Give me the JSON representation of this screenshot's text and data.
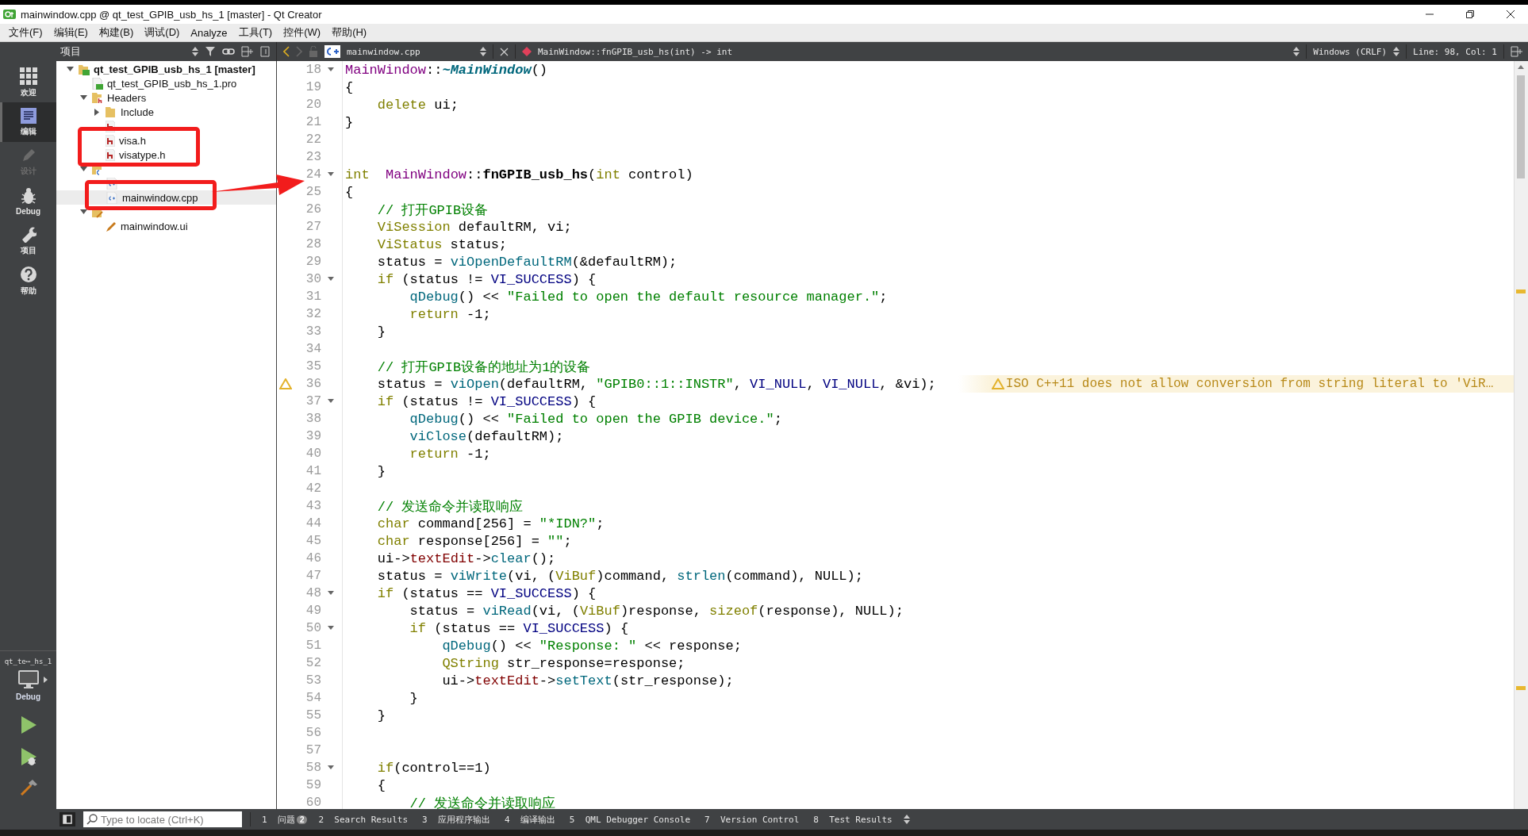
{
  "window": {
    "title": "mainwindow.cpp @ qt_test_GPIB_usb_hs_1 [master] - Qt Creator"
  },
  "menu": [
    "文件(F)",
    "编辑(E)",
    "构建(B)",
    "调试(D)",
    "Analyze",
    "工具(T)",
    "控件(W)",
    "帮助(H)"
  ],
  "modes": [
    {
      "label": "欢迎",
      "kind": "welcome",
      "selected": false,
      "disabled": false
    },
    {
      "label": "编辑",
      "kind": "edit",
      "selected": true,
      "disabled": false
    },
    {
      "label": "设计",
      "kind": "design",
      "selected": false,
      "disabled": true
    },
    {
      "label": "Debug",
      "kind": "debug",
      "selected": false,
      "disabled": false
    },
    {
      "label": "项目",
      "kind": "projects",
      "selected": false,
      "disabled": false
    },
    {
      "label": "帮助",
      "kind": "help",
      "selected": false,
      "disabled": false
    }
  ],
  "kit": {
    "project": "qt_te⋯_hs_1",
    "build": "Debug"
  },
  "actions": [
    {
      "kind": "run"
    },
    {
      "kind": "debug_run"
    },
    {
      "kind": "build"
    }
  ],
  "project_pane": {
    "title": "项目",
    "tree": [
      {
        "label": "qt_test_GPIB_usb_hs_1 [master]",
        "kind": "project",
        "expanded": true,
        "selected": false,
        "children": [
          {
            "label": "qt_test_GPIB_usb_hs_1.pro",
            "kind": "pro",
            "selected": false
          },
          {
            "label": "Headers",
            "kind": "headers",
            "expanded": true,
            "selected": false,
            "children": [
              {
                "label": "Include",
                "kind": "folder",
                "expanded": false,
                "selected": false
              },
              {
                "kind": "h",
                "selected": false
              },
              {
                "label": "visa.h",
                "kind": "h",
                "selected": false
              },
              {
                "label": "visatype.h",
                "kind": "h",
                "selected": false
              }
            ]
          },
          {
            "kind": "sources",
            "expanded": true,
            "selected": false,
            "children": [
              {
                "kind": "cpp",
                "selected": false
              },
              {
                "label": "mainwindow.cpp",
                "kind": "cpp",
                "selected": true
              }
            ]
          },
          {
            "kind": "forms",
            "expanded": true,
            "selected": false,
            "children": [
              {
                "label": "mainwindow.ui",
                "kind": "ui",
                "selected": false
              }
            ]
          }
        ]
      }
    ]
  },
  "editor_toolbar": {
    "file": "mainwindow.cpp",
    "symbol": "MainWindow::fnGPIB_usb_hs(int) -> int",
    "line_ending": "Windows (CRLF)",
    "position": "Line: 98, Col: 1"
  },
  "code": [
    {
      "number": "18",
      "foldable": true,
      "tokens": [
        {
          "kind": "cls",
          "text": "MainWindow"
        },
        {
          "kind": "plain",
          "text": "::"
        },
        {
          "kind": "dtor",
          "text": "~MainWindow"
        },
        {
          "kind": "plain",
          "text": "()"
        }
      ]
    },
    {
      "number": "19",
      "foldable": false,
      "tokens": [
        {
          "kind": "plain",
          "text": "{"
        }
      ]
    },
    {
      "number": "20",
      "foldable": false,
      "tokens": [
        {
          "kind": "kw",
          "text": "    delete"
        },
        {
          "kind": "plain",
          "text": " ui;"
        }
      ]
    },
    {
      "number": "21",
      "foldable": false,
      "tokens": [
        {
          "kind": "plain",
          "text": "}"
        }
      ]
    },
    {
      "number": "22",
      "foldable": false
    },
    {
      "number": "23",
      "foldable": false
    },
    {
      "number": "24",
      "foldable": true,
      "tokens": [
        {
          "kind": "kw",
          "text": "int  "
        },
        {
          "kind": "cls",
          "text": "MainWindow"
        },
        {
          "kind": "plain",
          "text": "::"
        },
        {
          "kind": "def",
          "text": "fnGPIB_usb_hs"
        },
        {
          "kind": "plain",
          "text": "("
        },
        {
          "kind": "kw",
          "text": "int"
        },
        {
          "kind": "plain",
          "text": " control)"
        }
      ]
    },
    {
      "number": "25",
      "foldable": false,
      "tokens": [
        {
          "kind": "plain",
          "text": "{"
        }
      ]
    },
    {
      "number": "26",
      "foldable": false,
      "tokens": [
        {
          "kind": "cm",
          "text": "    // 打开GPIB设备"
        }
      ]
    },
    {
      "number": "27",
      "foldable": false,
      "tokens": [
        {
          "kind": "type",
          "text": "    ViSession"
        },
        {
          "kind": "plain",
          "text": " defaultRM, vi;"
        }
      ]
    },
    {
      "number": "28",
      "foldable": false,
      "tokens": [
        {
          "kind": "type",
          "text": "    ViStatus"
        },
        {
          "kind": "plain",
          "text": " status;"
        }
      ]
    },
    {
      "number": "29",
      "foldable": false,
      "tokens": [
        {
          "kind": "plain",
          "text": "    status = "
        },
        {
          "kind": "fn",
          "text": "viOpenDefaultRM"
        },
        {
          "kind": "plain",
          "text": "(&defaultRM);"
        }
      ]
    },
    {
      "number": "30",
      "foldable": true,
      "tokens": [
        {
          "kind": "kw",
          "text": "    if"
        },
        {
          "kind": "plain",
          "text": " (status != "
        },
        {
          "kind": "mac",
          "text": "VI_SUCCESS"
        },
        {
          "kind": "plain",
          "text": ") {"
        }
      ]
    },
    {
      "number": "31",
      "foldable": false,
      "tokens": [
        {
          "kind": "fn",
          "text": "        qDebug"
        },
        {
          "kind": "plain",
          "text": "() << "
        },
        {
          "kind": "str",
          "text": "\"Failed to open the default resource manager.\""
        },
        {
          "kind": "plain",
          "text": ";"
        }
      ]
    },
    {
      "number": "32",
      "foldable": false,
      "tokens": [
        {
          "kind": "kw",
          "text": "        return"
        },
        {
          "kind": "plain",
          "text": " -1;"
        }
      ]
    },
    {
      "number": "33",
      "foldable": false,
      "tokens": [
        {
          "kind": "plain",
          "text": "    }"
        }
      ]
    },
    {
      "number": "34",
      "foldable": false
    },
    {
      "number": "35",
      "foldable": false,
      "tokens": [
        {
          "kind": "cm",
          "text": "    // 打开GPIB设备的地址为1的设备"
        }
      ]
    },
    {
      "number": "36",
      "foldable": false,
      "tokens": [
        {
          "kind": "plain",
          "text": "    status = "
        },
        {
          "kind": "fn",
          "text": "viOpen"
        },
        {
          "kind": "plain",
          "text": "(defaultRM, "
        },
        {
          "kind": "str",
          "text": "\"GPIB0::1::INSTR\""
        },
        {
          "kind": "plain",
          "text": ", "
        },
        {
          "kind": "mac",
          "text": "VI_NULL"
        },
        {
          "kind": "plain",
          "text": ", "
        },
        {
          "kind": "mac",
          "text": "VI_NULL"
        },
        {
          "kind": "plain",
          "text": ", &vi);"
        }
      ],
      "warning": "ISO C++11 does not allow conversion from string literal to 'ViR…"
    },
    {
      "number": "37",
      "foldable": true,
      "tokens": [
        {
          "kind": "kw",
          "text": "    if"
        },
        {
          "kind": "plain",
          "text": " (status != "
        },
        {
          "kind": "mac",
          "text": "VI_SUCCESS"
        },
        {
          "kind": "plain",
          "text": ") {"
        }
      ]
    },
    {
      "number": "38",
      "foldable": false,
      "tokens": [
        {
          "kind": "fn",
          "text": "        qDebug"
        },
        {
          "kind": "plain",
          "text": "() << "
        },
        {
          "kind": "str",
          "text": "\"Failed to open the GPIB device.\""
        },
        {
          "kind": "plain",
          "text": ";"
        }
      ]
    },
    {
      "number": "39",
      "foldable": false,
      "tokens": [
        {
          "kind": "fn",
          "text": "        viClose"
        },
        {
          "kind": "plain",
          "text": "(defaultRM);"
        }
      ]
    },
    {
      "number": "40",
      "foldable": false,
      "tokens": [
        {
          "kind": "kw",
          "text": "        return"
        },
        {
          "kind": "plain",
          "text": " -1;"
        }
      ]
    },
    {
      "number": "41",
      "foldable": false,
      "tokens": [
        {
          "kind": "plain",
          "text": "    }"
        }
      ]
    },
    {
      "number": "42",
      "foldable": false
    },
    {
      "number": "43",
      "foldable": false,
      "tokens": [
        {
          "kind": "cm",
          "text": "    // 发送命令并读取响应"
        }
      ]
    },
    {
      "number": "44",
      "foldable": false,
      "tokens": [
        {
          "kind": "kw",
          "text": "    char"
        },
        {
          "kind": "plain",
          "text": " command[256] = "
        },
        {
          "kind": "str",
          "text": "\"*IDN?\""
        },
        {
          "kind": "plain",
          "text": ";"
        }
      ]
    },
    {
      "number": "45",
      "foldable": false,
      "tokens": [
        {
          "kind": "kw",
          "text": "    char"
        },
        {
          "kind": "plain",
          "text": " response[256] = "
        },
        {
          "kind": "str",
          "text": "\"\""
        },
        {
          "kind": "plain",
          "text": ";"
        }
      ]
    },
    {
      "number": "46",
      "foldable": false,
      "tokens": [
        {
          "kind": "plain",
          "text": "    ui->"
        },
        {
          "kind": "field",
          "text": "textEdit"
        },
        {
          "kind": "plain",
          "text": "->"
        },
        {
          "kind": "fn",
          "text": "clear"
        },
        {
          "kind": "plain",
          "text": "();"
        }
      ]
    },
    {
      "number": "47",
      "foldable": false,
      "tokens": [
        {
          "kind": "plain",
          "text": "    status = "
        },
        {
          "kind": "fn",
          "text": "viWrite"
        },
        {
          "kind": "plain",
          "text": "(vi, ("
        },
        {
          "kind": "type",
          "text": "ViBuf"
        },
        {
          "kind": "plain",
          "text": ")command, "
        },
        {
          "kind": "fn",
          "text": "strlen"
        },
        {
          "kind": "plain",
          "text": "(command), NULL);"
        }
      ]
    },
    {
      "number": "48",
      "foldable": true,
      "tokens": [
        {
          "kind": "kw",
          "text": "    if"
        },
        {
          "kind": "plain",
          "text": " (status == "
        },
        {
          "kind": "mac",
          "text": "VI_SUCCESS"
        },
        {
          "kind": "plain",
          "text": ") {"
        }
      ]
    },
    {
      "number": "49",
      "foldable": false,
      "tokens": [
        {
          "kind": "plain",
          "text": "        status = "
        },
        {
          "kind": "fn",
          "text": "viRead"
        },
        {
          "kind": "plain",
          "text": "(vi, ("
        },
        {
          "kind": "type",
          "text": "ViBuf"
        },
        {
          "kind": "plain",
          "text": ")response, "
        },
        {
          "kind": "kw",
          "text": "sizeof"
        },
        {
          "kind": "plain",
          "text": "(response), NULL);"
        }
      ]
    },
    {
      "number": "50",
      "foldable": true,
      "tokens": [
        {
          "kind": "kw",
          "text": "        if"
        },
        {
          "kind": "plain",
          "text": " (status == "
        },
        {
          "kind": "mac",
          "text": "VI_SUCCESS"
        },
        {
          "kind": "plain",
          "text": ") {"
        }
      ]
    },
    {
      "number": "51",
      "foldable": false,
      "tokens": [
        {
          "kind": "fn",
          "text": "            qDebug"
        },
        {
          "kind": "plain",
          "text": "() << "
        },
        {
          "kind": "str",
          "text": "\"Response: \""
        },
        {
          "kind": "plain",
          "text": " << response;"
        }
      ]
    },
    {
      "number": "52",
      "foldable": false,
      "tokens": [
        {
          "kind": "type",
          "text": "            QString"
        },
        {
          "kind": "plain",
          "text": " str_response=response;"
        }
      ]
    },
    {
      "number": "53",
      "foldable": false,
      "tokens": [
        {
          "kind": "plain",
          "text": "            ui->"
        },
        {
          "kind": "field",
          "text": "textEdit"
        },
        {
          "kind": "plain",
          "text": "->"
        },
        {
          "kind": "fn",
          "text": "setText"
        },
        {
          "kind": "plain",
          "text": "(str_response);"
        }
      ]
    },
    {
      "number": "54",
      "foldable": false,
      "tokens": [
        {
          "kind": "plain",
          "text": "        }"
        }
      ]
    },
    {
      "number": "55",
      "foldable": false,
      "tokens": [
        {
          "kind": "plain",
          "text": "    }"
        }
      ]
    },
    {
      "number": "56",
      "foldable": false
    },
    {
      "number": "57",
      "foldable": false
    },
    {
      "number": "58",
      "foldable": true,
      "tokens": [
        {
          "kind": "kw",
          "text": "    if"
        },
        {
          "kind": "plain",
          "text": "(control==1)"
        }
      ]
    },
    {
      "number": "59",
      "foldable": false,
      "tokens": [
        {
          "kind": "plain",
          "text": "    {"
        }
      ]
    },
    {
      "number": "60",
      "foldable": false,
      "tokens": [
        {
          "kind": "cm",
          "text": "        // 发送命令并读取响应"
        }
      ]
    }
  ],
  "locator": {
    "placeholder": "Type to locate (Ctrl+K)"
  },
  "output_panes": [
    {
      "number": "1",
      "label": "问题",
      "badge": "2"
    },
    {
      "number": "2",
      "label": "Search Results"
    },
    {
      "number": "3",
      "label": "应用程序输出"
    },
    {
      "number": "4",
      "label": "编译输出"
    },
    {
      "number": "5",
      "label": "QML Debugger Console"
    },
    {
      "number": "7",
      "label": "Version Control"
    },
    {
      "number": "8",
      "label": "Test Results"
    }
  ]
}
